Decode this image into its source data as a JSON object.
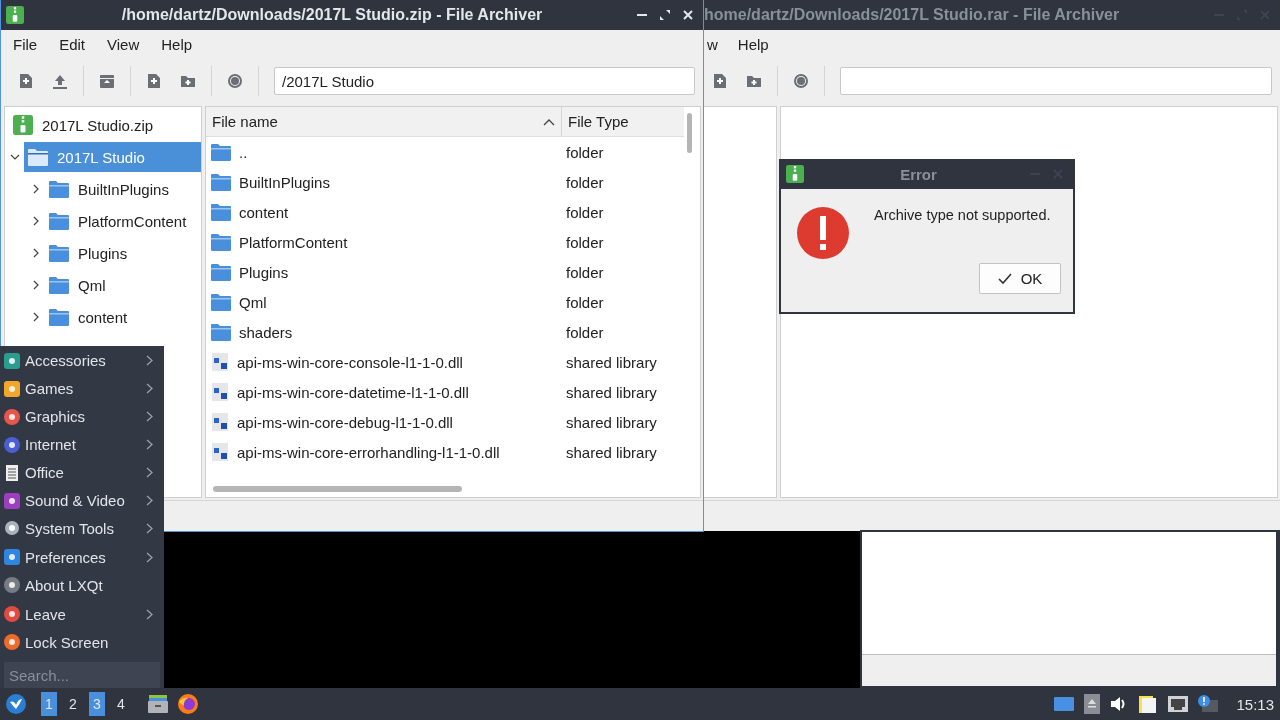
{
  "back_window": {
    "title": "home/dartz/Downloads/2017L Studio.rar - File Archiver",
    "menu": [
      "w",
      "Help"
    ]
  },
  "window": {
    "title": "/home/dartz/Downloads/2017L Studio.zip - File Archiver",
    "menu": [
      "File",
      "Edit",
      "View",
      "Help"
    ],
    "path": "/2017L Studio",
    "tree": {
      "label": "2017L Studio.zip",
      "selected": false,
      "children": [
        {
          "label": "2017L Studio",
          "selected": true,
          "expanded": true,
          "children": [
            {
              "label": "BuiltInPlugins",
              "selected": false,
              "expanded": false
            },
            {
              "label": "PlatformContent",
              "selected": false,
              "expanded": false
            },
            {
              "label": "Plugins",
              "selected": false,
              "expanded": false
            },
            {
              "label": "Qml",
              "selected": false,
              "expanded": false
            },
            {
              "label": "content",
              "selected": false,
              "expanded": false
            }
          ]
        }
      ]
    },
    "columns": [
      {
        "label": "File name",
        "sorted": true
      },
      {
        "label": "File Type",
        "sorted": false
      }
    ],
    "rows": [
      {
        "name": "..",
        "type": "folder",
        "kind": "folder"
      },
      {
        "name": "BuiltInPlugins",
        "type": "folder",
        "kind": "folder"
      },
      {
        "name": "content",
        "type": "folder",
        "kind": "folder"
      },
      {
        "name": "PlatformContent",
        "type": "folder",
        "kind": "folder"
      },
      {
        "name": "Plugins",
        "type": "folder",
        "kind": "folder"
      },
      {
        "name": "Qml",
        "type": "folder",
        "kind": "folder"
      },
      {
        "name": "shaders",
        "type": "folder",
        "kind": "folder"
      },
      {
        "name": "api-ms-win-core-console-l1-1-0.dll",
        "type": "shared library",
        "kind": "file"
      },
      {
        "name": "api-ms-win-core-datetime-l1-1-0.dll",
        "type": "shared library",
        "kind": "file"
      },
      {
        "name": "api-ms-win-core-debug-l1-1-0.dll",
        "type": "shared library",
        "kind": "file"
      },
      {
        "name": "api-ms-win-core-errorhandling-l1-1-0.dll",
        "type": "shared library",
        "kind": "file"
      }
    ]
  },
  "error_dialog": {
    "title": "Error",
    "message": "Archive type not supported.",
    "buttons": [
      "OK"
    ]
  },
  "start_menu": {
    "items": [
      {
        "label": "Accessories",
        "submenu": true
      },
      {
        "label": "Games",
        "submenu": true
      },
      {
        "label": "Graphics",
        "submenu": true
      },
      {
        "label": "Internet",
        "submenu": true
      },
      {
        "label": "Office",
        "submenu": true
      },
      {
        "label": "Sound & Video",
        "submenu": true
      },
      {
        "label": "System Tools",
        "submenu": true
      },
      {
        "label": "Preferences",
        "submenu": true
      },
      {
        "label": "About LXQt",
        "submenu": false
      },
      {
        "label": "Leave",
        "submenu": true
      },
      {
        "label": "Lock Screen",
        "submenu": false
      }
    ],
    "search": {
      "placeholder": "Search..."
    }
  },
  "taskbar": {
    "desktops": [
      {
        "label": "1",
        "selected": true
      },
      {
        "label": "2",
        "selected": false
      },
      {
        "label": "3",
        "selected": true
      },
      {
        "label": "4",
        "selected": false
      }
    ],
    "clock": "15:13"
  }
}
